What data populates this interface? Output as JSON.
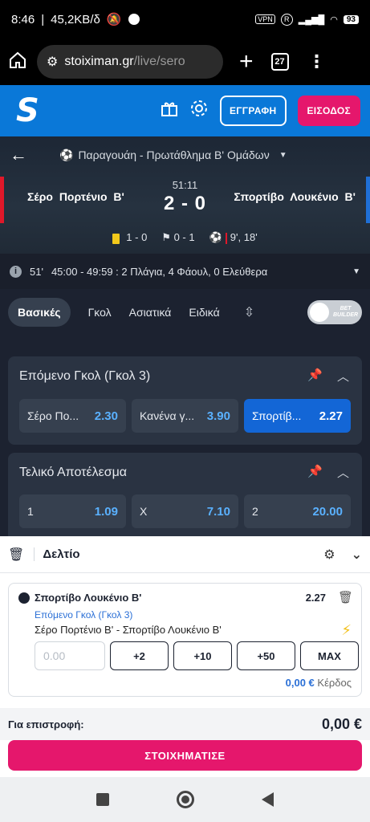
{
  "status_bar": {
    "time": "8:46",
    "speed": "45,2KB/δ",
    "vpn": "VPN",
    "r": "R",
    "battery": "93"
  },
  "browser": {
    "url_host": "stoiximan.gr",
    "url_path": "/live/sero",
    "tab_count": "27"
  },
  "site_header": {
    "logo": "S",
    "register_label": "ΕΓΓΡΑΦΗ",
    "login_label": "ΕΙΣΟΔΟΣ"
  },
  "match": {
    "league": "Παραγουάη - Πρωτάθλημα Β' Ομάδων",
    "home": "Σέρο Πορτένιο Β'",
    "away": "Σπορτίβο Λουκένιο Β'",
    "clock": "51:11",
    "score": "2 - 0",
    "yellow_cards": "1 - 0",
    "corners": "0 - 1",
    "goal_minutes": "9', 18'"
  },
  "info_bar": {
    "minute": "51'",
    "text": "45:00 - 49:59 : 2 Πλάγια, 4 Φάουλ, 0 Ελεύθερα"
  },
  "tabs": [
    "Βασικές",
    "Γκολ",
    "Ασιατικά",
    "Ειδικά"
  ],
  "bet_builder": {
    "line1": "BET",
    "line2": "BUILDER"
  },
  "markets": [
    {
      "title": "Επόμενο Γκολ (Γκολ 3)",
      "odds": [
        {
          "label": "Σέρο Πο...",
          "value": "2.30"
        },
        {
          "label": "Κανένα γ...",
          "value": "3.90"
        },
        {
          "label": "Σπορτίβ...",
          "value": "2.27"
        }
      ]
    },
    {
      "title": "Τελικό Αποτέλεσμα",
      "odds": [
        {
          "label": "1",
          "value": "1.09"
        },
        {
          "label": "X",
          "value": "7.10"
        },
        {
          "label": "2",
          "value": "20.00"
        }
      ]
    }
  ],
  "slip": {
    "title": "Δελτίο",
    "selection": "Σπορτίβο Λουκένιο Β'",
    "odd": "2.27",
    "market": "Επόμενο Γκολ (Γκολ 3)",
    "match": "Σέρο Πορτένιο Β' - Σπορτίβο Λουκένιο Β'",
    "stake_placeholder": "0.00",
    "quick": [
      "+2",
      "+10",
      "+50",
      "MAX"
    ],
    "profit_amount": "0,00 €",
    "profit_label": "Κέρδος",
    "return_label": "Για επιστροφή:",
    "return_amount": "0,00 €",
    "bet_button": "ΣΤΟΙΧΗΜΑΤΙΣΕ"
  },
  "colors": {
    "brand_blue": "#0a78d8",
    "accent_pink": "#e5176c",
    "odd_blue": "#5ab1ff",
    "selected": "#1366d6"
  }
}
